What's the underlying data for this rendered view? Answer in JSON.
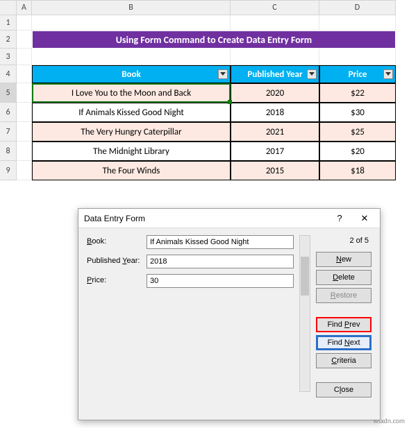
{
  "columns": [
    "A",
    "B",
    "C",
    "D"
  ],
  "rows": [
    "1",
    "2",
    "3",
    "4",
    "5",
    "6",
    "7",
    "8",
    "9"
  ],
  "selected_row": "5",
  "title": "Using Form Command to Create Data Entry Form",
  "headers": {
    "book": "Book",
    "year": "Published Year",
    "price": "Price"
  },
  "table": [
    {
      "book": "I Love You to the Moon and Back",
      "year": "2020",
      "price": "$22"
    },
    {
      "book": "If Animals Kissed Good Night",
      "year": "2018",
      "price": "$30"
    },
    {
      "book": "The Very Hungry Caterpillar",
      "year": "2021",
      "price": "$25"
    },
    {
      "book": "The Midnight Library",
      "year": "2017",
      "price": "$20"
    },
    {
      "book": "The Four Winds",
      "year": "2015",
      "price": "$18"
    }
  ],
  "dialog": {
    "title": "Data Entry Form",
    "counter": "2 of 5",
    "labels": {
      "book": "Book:",
      "year": "Published Year:",
      "price": "Price:"
    },
    "values": {
      "book": "If Animals Kissed Good Night",
      "year": "2018",
      "price": "30"
    },
    "buttons": {
      "new": "New",
      "delete": "Delete",
      "restore": "Restore",
      "find_prev": "Find Prev",
      "find_next": "Find Next",
      "criteria": "Criteria",
      "close": "Close"
    }
  },
  "watermark": "wsxdn.com"
}
